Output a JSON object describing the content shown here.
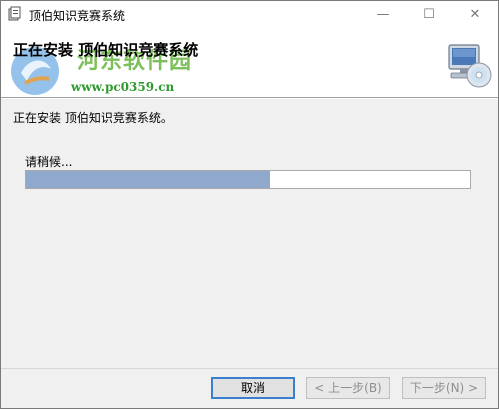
{
  "window": {
    "title": "顶伯知识竞赛系统",
    "minimize_glyph": "—",
    "maximize_glyph": "☐",
    "close_glyph": "✕"
  },
  "header": {
    "title": "正在安装 顶伯知识竞赛系统",
    "icon": "computer-cd-icon"
  },
  "watermark": {
    "text": "河东软件园",
    "url": "www.pc0359.cn"
  },
  "body": {
    "status_text": "正在安装 顶伯知识竞赛系统。",
    "wait_label": "请稍候...",
    "progress_fraction": 0.55
  },
  "buttons": {
    "cancel": "取消",
    "back": "< 上一步(B)",
    "next": "下一步(N) >"
  },
  "colors": {
    "progress_fill": "#8fa8cc",
    "watermark_green": "#67b53e",
    "focus_border": "#3c7fd0"
  }
}
